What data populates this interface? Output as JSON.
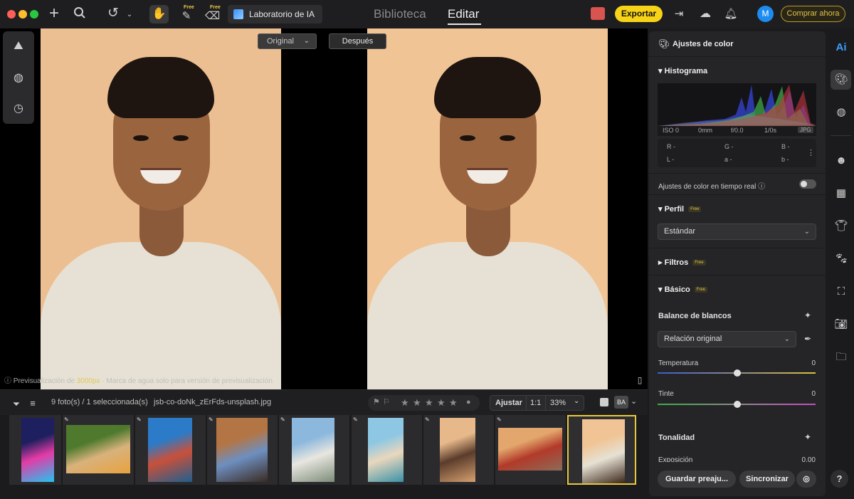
{
  "topbar": {
    "ai_lab_label": "Laboratorio de IA",
    "tab_library": "Biblioteca",
    "tab_edit": "Editar",
    "free_1": "Free",
    "free_2": "Free",
    "export_label": "Exportar",
    "avatar_initial": "M",
    "buy_label": "Comprar ahora"
  },
  "canvas": {
    "compare_original": "Original",
    "compare_after": "Después",
    "preview_prefix": "Previsualización de",
    "preview_size": "3000px",
    "preview_suffix": "· Marca de agua solo para versión de previsualización"
  },
  "filmstrip": {
    "count_label": "9 foto(s) / 1 seleccionada(s)",
    "filename": "jsb-co-doNk_zErFds-unsplash.jpg",
    "fit_label": "Ajustar",
    "ratio_label": "1:1",
    "zoom_label": "33%",
    "thumbnails": [
      {
        "subject": "neon-sign",
        "colors": [
          "#1d1f5e",
          "#e43ba6",
          "#22c4f0"
        ]
      },
      {
        "subject": "puppies",
        "colors": [
          "#4f7a2e",
          "#d8b27c",
          "#e8a23e"
        ]
      },
      {
        "subject": "waterfront-city",
        "colors": [
          "#2b7bc8",
          "#c9503a",
          "#1f5f8e"
        ]
      },
      {
        "subject": "old-street",
        "colors": [
          "#b47544",
          "#6d8fc0",
          "#3b2a22"
        ]
      },
      {
        "subject": "city-skyline",
        "colors": [
          "#8bb8dc",
          "#e8e6e0",
          "#7c8c78"
        ]
      },
      {
        "subject": "beach-crowd",
        "colors": [
          "#8ec7e3",
          "#e9d7bd",
          "#3a92a8"
        ]
      },
      {
        "subject": "sunset-rocks",
        "colors": [
          "#e7b98a",
          "#5b3c2b",
          "#d5a070"
        ]
      },
      {
        "subject": "hot-air-balloon",
        "colors": [
          "#e3a66c",
          "#b23a2a",
          "#8d6b58"
        ]
      },
      {
        "subject": "portrait",
        "colors": [
          "#f0c495",
          "#e6e1d4",
          "#3a2418"
        ]
      }
    ]
  },
  "panel": {
    "color_title": "Ajustes de color",
    "histogram_title": "Histograma",
    "iso": "ISO 0",
    "focal": "0mm",
    "aperture": "f/0.0",
    "shutter": "1/0s",
    "format": "JPG",
    "r": "R -",
    "g": "G -",
    "b": "B -",
    "l": "L -",
    "a": "a -",
    "bb": "b -",
    "realtime_label": "Ajustes de color en tiempo real",
    "profile_title": "Perfil",
    "profile_value": "Estándar",
    "filters_title": "Filtros",
    "basic_title": "Básico",
    "free": "Free",
    "wb_title": "Balance de blancos",
    "wb_value": "Relación original",
    "temp_label": "Temperatura",
    "temp_value": "0",
    "tint_label": "Tinte",
    "tint_value": "0",
    "tone_title": "Tonalidad",
    "exposure_label": "Exposición",
    "exposure_value": "0.00",
    "save_preset": "Guardar preaju...",
    "sync": "Sincronizar"
  },
  "rail": {
    "ai_label": "Ai",
    "help_label": "?"
  },
  "colors": {
    "accent_yellow": "#f6d317",
    "avatar_blue": "#1d8cf0",
    "selection_border": "#e8c93a"
  }
}
